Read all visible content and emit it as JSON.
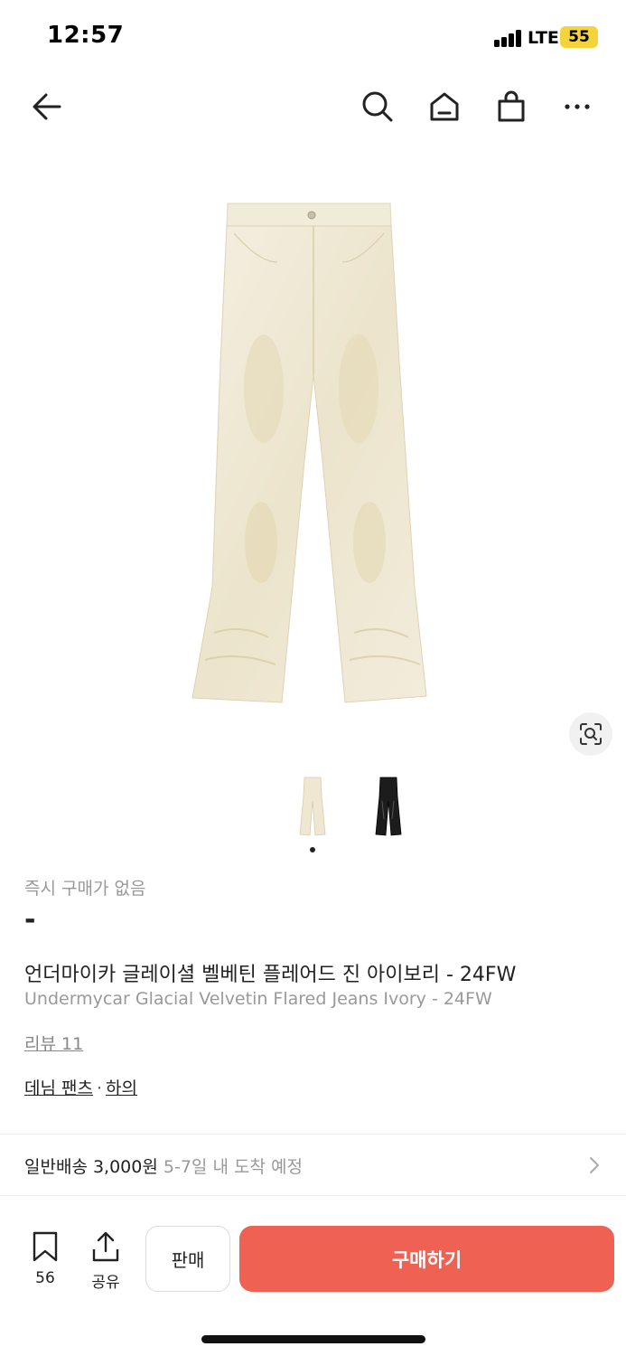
{
  "status": {
    "time": "12:57",
    "network": "LTE",
    "battery": "55"
  },
  "nav": {
    "back_icon": "arrow-left-icon",
    "icons": [
      "search-icon",
      "home-icon",
      "shopping-bag-icon",
      "more-icon"
    ]
  },
  "product": {
    "image_alt": "ivory flared jeans",
    "thumbnails": [
      "ivory",
      "black"
    ],
    "selected_thumbnail": 0,
    "instant_buy_status": "즉시 구매가 없음",
    "price": "-",
    "title_ko": "언더마이카 글레이셜 벨베틴 플레어드 진 아이보리 - 24FW",
    "title_en": "Undermycar Glacial Velvetin Flared Jeans Ivory - 24FW",
    "review_link": "리뷰 11",
    "category_1": "데님 팬츠",
    "category_sep": "·",
    "category_2": "하의"
  },
  "shipping": {
    "label": "일반배송 3,000원",
    "eta": "5-7일 내 도착 예정"
  },
  "bottom_bar": {
    "bookmark_count": "56",
    "share_label": "공유",
    "sell_label": "판매",
    "buy_label": "구매하기"
  },
  "colors": {
    "buy_button": "#ef6253",
    "battery": "#f5d33b"
  }
}
